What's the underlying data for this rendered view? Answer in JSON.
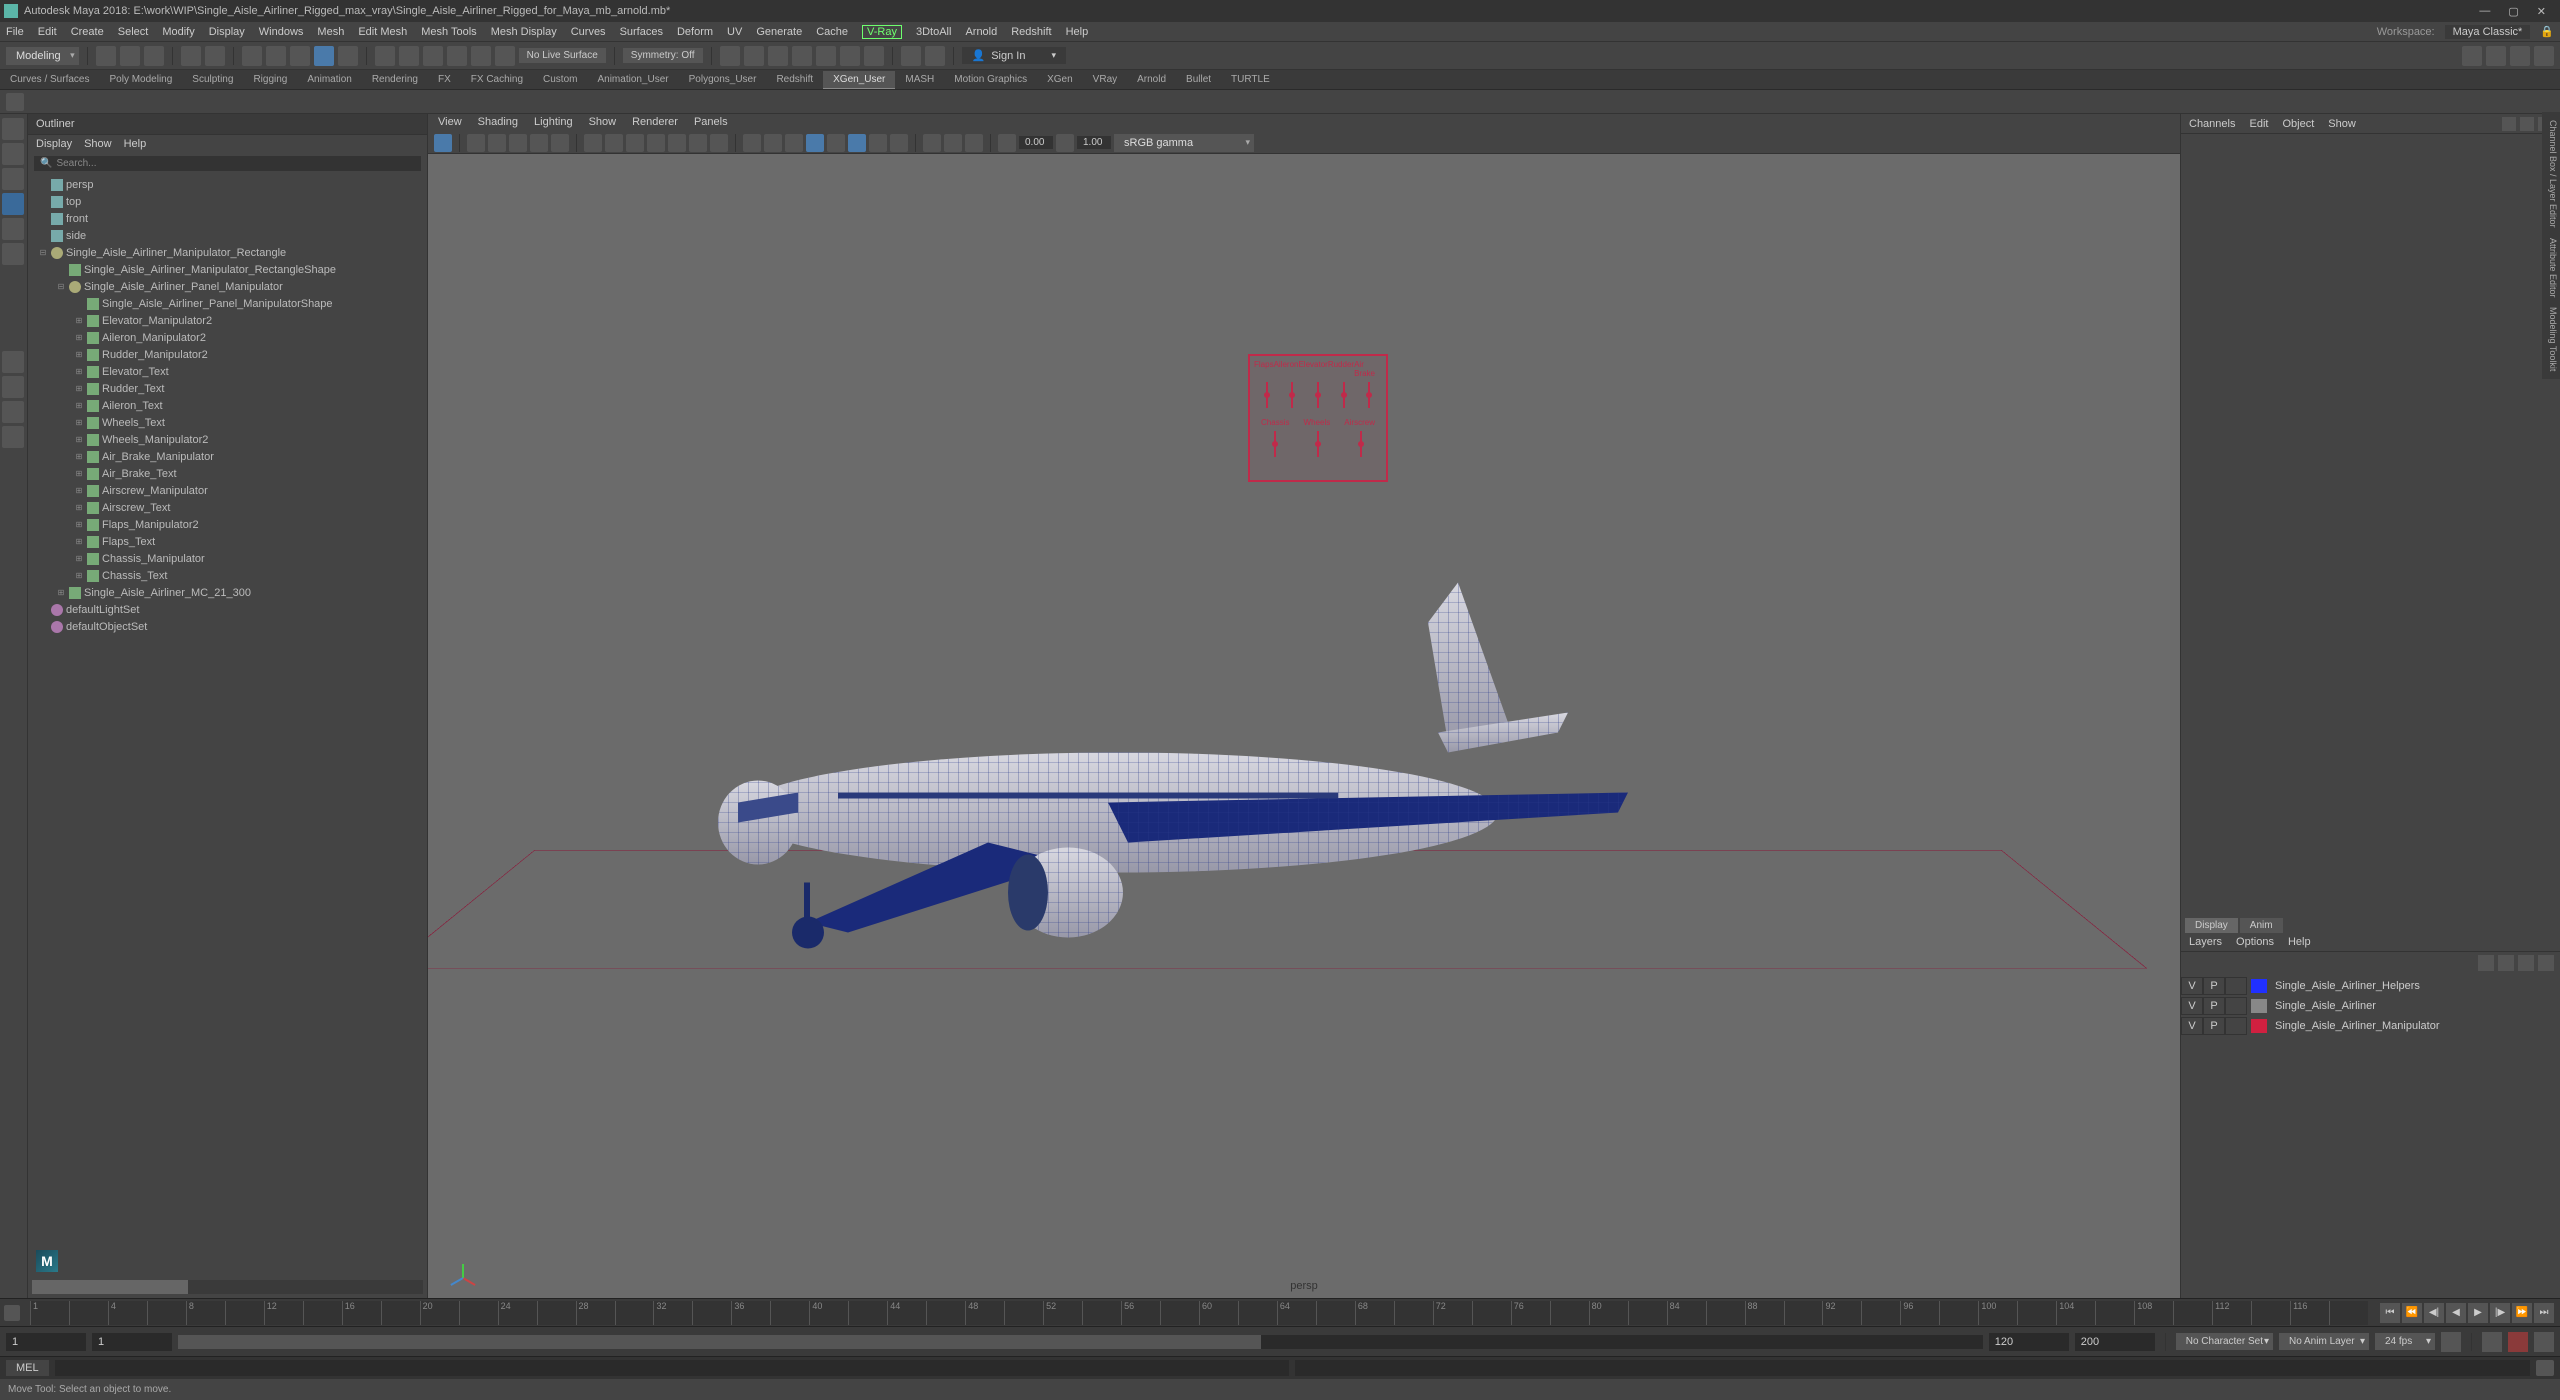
{
  "title": "Autodesk Maya 2018: E:\\work\\WIP\\Single_Aisle_Airliner_Rigged_max_vray\\Single_Aisle_Airliner_Rigged_for_Maya_mb_arnold.mb*",
  "menubar": [
    "File",
    "Edit",
    "Create",
    "Select",
    "Modify",
    "Display",
    "Windows",
    "Mesh",
    "Edit Mesh",
    "Mesh Tools",
    "Mesh Display",
    "Curves",
    "Surfaces",
    "Deform",
    "UV",
    "Generate",
    "Cache"
  ],
  "menubar_plugins": [
    "V-Ray",
    "3DtoAll",
    "Arnold",
    "Redshift",
    "Help"
  ],
  "workspace_label": "Workspace:",
  "workspace_value": "Maya Classic*",
  "mode_dropdown": "Modeling",
  "status_text1": "No Live Surface",
  "status_text2": "Symmetry: Off",
  "signin": "Sign In",
  "shelf_tabs": [
    "Curves / Surfaces",
    "Poly Modeling",
    "Sculpting",
    "Rigging",
    "Animation",
    "Rendering",
    "FX",
    "FX Caching",
    "Custom",
    "Animation_User",
    "Polygons_User",
    "Redshift",
    "XGen_User",
    "MASH",
    "Motion Graphics",
    "XGen",
    "VRay",
    "Arnold",
    "Bullet",
    "TURTLE"
  ],
  "shelf_active": 12,
  "outliner": {
    "title": "Outliner",
    "menu": [
      "Display",
      "Show",
      "Help"
    ],
    "search": "Search...",
    "tree": [
      {
        "d": 0,
        "t": "cam",
        "n": "persp",
        "tw": ""
      },
      {
        "d": 0,
        "t": "cam",
        "n": "top",
        "tw": ""
      },
      {
        "d": 0,
        "t": "cam",
        "n": "front",
        "tw": ""
      },
      {
        "d": 0,
        "t": "cam",
        "n": "side",
        "tw": ""
      },
      {
        "d": 0,
        "t": "curve",
        "n": "Single_Aisle_Airliner_Manipulator_Rectangle",
        "tw": "⊟"
      },
      {
        "d": 1,
        "t": "xform",
        "n": "Single_Aisle_Airliner_Manipulator_RectangleShape",
        "tw": ""
      },
      {
        "d": 1,
        "t": "curve",
        "n": "Single_Aisle_Airliner_Panel_Manipulator",
        "tw": "⊟"
      },
      {
        "d": 2,
        "t": "xform",
        "n": "Single_Aisle_Airliner_Panel_ManipulatorShape",
        "tw": ""
      },
      {
        "d": 2,
        "t": "xform",
        "n": "Elevator_Manipulator2",
        "tw": "⊞"
      },
      {
        "d": 2,
        "t": "xform",
        "n": "Aileron_Manipulator2",
        "tw": "⊞"
      },
      {
        "d": 2,
        "t": "xform",
        "n": "Rudder_Manipulator2",
        "tw": "⊞"
      },
      {
        "d": 2,
        "t": "xform",
        "n": "Elevator_Text",
        "tw": "⊞"
      },
      {
        "d": 2,
        "t": "xform",
        "n": "Rudder_Text",
        "tw": "⊞"
      },
      {
        "d": 2,
        "t": "xform",
        "n": "Aileron_Text",
        "tw": "⊞"
      },
      {
        "d": 2,
        "t": "xform",
        "n": "Wheels_Text",
        "tw": "⊞"
      },
      {
        "d": 2,
        "t": "xform",
        "n": "Wheels_Manipulator2",
        "tw": "⊞"
      },
      {
        "d": 2,
        "t": "xform",
        "n": "Air_Brake_Manipulator",
        "tw": "⊞"
      },
      {
        "d": 2,
        "t": "xform",
        "n": "Air_Brake_Text",
        "tw": "⊞"
      },
      {
        "d": 2,
        "t": "xform",
        "n": "Airscrew_Manipulator",
        "tw": "⊞"
      },
      {
        "d": 2,
        "t": "xform",
        "n": "Airscrew_Text",
        "tw": "⊞"
      },
      {
        "d": 2,
        "t": "xform",
        "n": "Flaps_Manipulator2",
        "tw": "⊞"
      },
      {
        "d": 2,
        "t": "xform",
        "n": "Flaps_Text",
        "tw": "⊞"
      },
      {
        "d": 2,
        "t": "xform",
        "n": "Chassis_Manipulator",
        "tw": "⊞"
      },
      {
        "d": 2,
        "t": "xform",
        "n": "Chassis_Text",
        "tw": "⊞"
      },
      {
        "d": 1,
        "t": "xform",
        "n": "Single_Aisle_Airliner_MC_21_300",
        "tw": "⊞"
      },
      {
        "d": 0,
        "t": "set",
        "n": "defaultLightSet",
        "tw": ""
      },
      {
        "d": 0,
        "t": "set",
        "n": "defaultObjectSet",
        "tw": ""
      }
    ]
  },
  "viewport": {
    "menu": [
      "View",
      "Shading",
      "Lighting",
      "Show",
      "Renderer",
      "Panels"
    ],
    "gamma": "sRGB gamma",
    "exposure": "0.00",
    "gamma_val": "1.00",
    "camera": "persp",
    "ctrl_labels1": [
      "Flaps",
      "Aileron",
      "Elevator",
      "Rudder",
      "Air Brake"
    ],
    "ctrl_labels2": [
      "Chassis",
      "Wheels",
      "Airscrew"
    ]
  },
  "channel": {
    "tabs": [
      "Channels",
      "Edit",
      "Object",
      "Show"
    ],
    "display_tabs": [
      "Display",
      "Anim"
    ],
    "layer_menu": [
      "Layers",
      "Options",
      "Help"
    ],
    "layers": [
      {
        "v": "V",
        "p": "P",
        "c": "#2030ff",
        "n": "Single_Aisle_Airliner_Helpers"
      },
      {
        "v": "V",
        "p": "P",
        "c": "#888888",
        "n": "Single_Aisle_Airliner"
      },
      {
        "v": "V",
        "p": "P",
        "c": "#d02040",
        "n": "Single_Aisle_Airliner_Manipulator"
      }
    ]
  },
  "vtabs": [
    "Channel Box / Layer Editor",
    "Attribute Editor",
    "Modeling Toolkit"
  ],
  "timeline": {
    "start": "1",
    "end": "120",
    "range_start": "1",
    "range_end": "120",
    "total_end": "200",
    "charset": "No Character Set",
    "animlayer": "No Anim Layer",
    "fps": "24 fps"
  },
  "cmd": "MEL",
  "help": "Move Tool: Select an object to move."
}
